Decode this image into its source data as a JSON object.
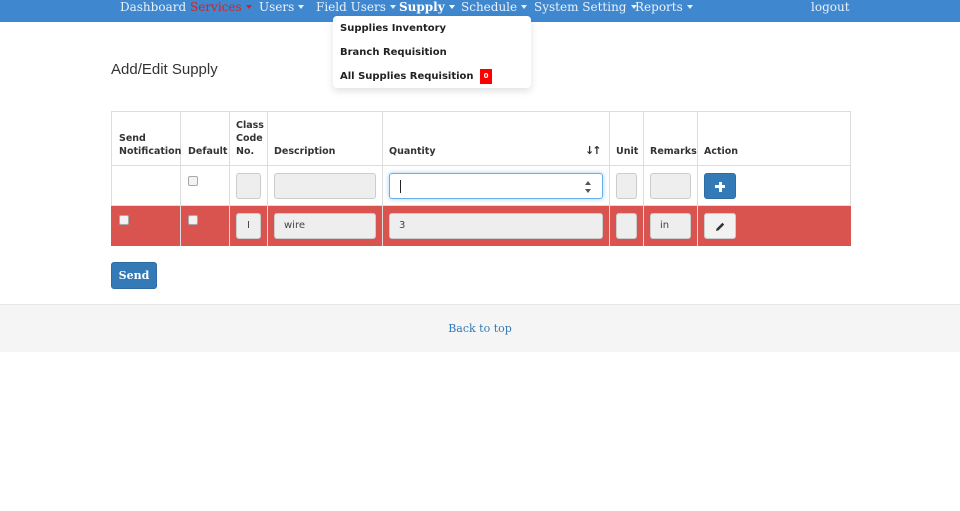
{
  "nav": {
    "dashboard": "Dashboard",
    "services": "Services",
    "users": "Users",
    "field_users": "Field Users",
    "supply": "Supply",
    "schedule": "Schedule",
    "system_setting": "System Setting",
    "reports": "Reports",
    "logout": "logout"
  },
  "supply_menu": {
    "items": [
      "Supplies Inventory",
      "Branch Requisition",
      "All Supplies Requisition"
    ],
    "badge": "0"
  },
  "page": {
    "title": "Add/Edit Supply"
  },
  "table": {
    "headers": {
      "send_notification_1": "Send",
      "send_notification_2": "Notification",
      "default": "Default",
      "class_code_1": "Class",
      "class_code_2": "Code",
      "class_code_3": "No.",
      "description": "Description",
      "quantity": "Quantity",
      "unit": "Unit",
      "remarks": "Remarks",
      "action": "Action"
    },
    "sort_icon": "↓↑",
    "new_row": {
      "class_code": "",
      "description": "",
      "quantity": "",
      "unit": "",
      "remarks": ""
    },
    "row": {
      "class_code": "I",
      "description": "wire",
      "quantity": "3",
      "unit": "",
      "remarks": "in"
    }
  },
  "send_label": "Send",
  "footer": {
    "back_to_top": "Back to top"
  },
  "colors": {
    "navbar": "#3f88cf",
    "primary": "#337ab7",
    "danger_row": "#d9534f",
    "badge": "#ff0000"
  }
}
